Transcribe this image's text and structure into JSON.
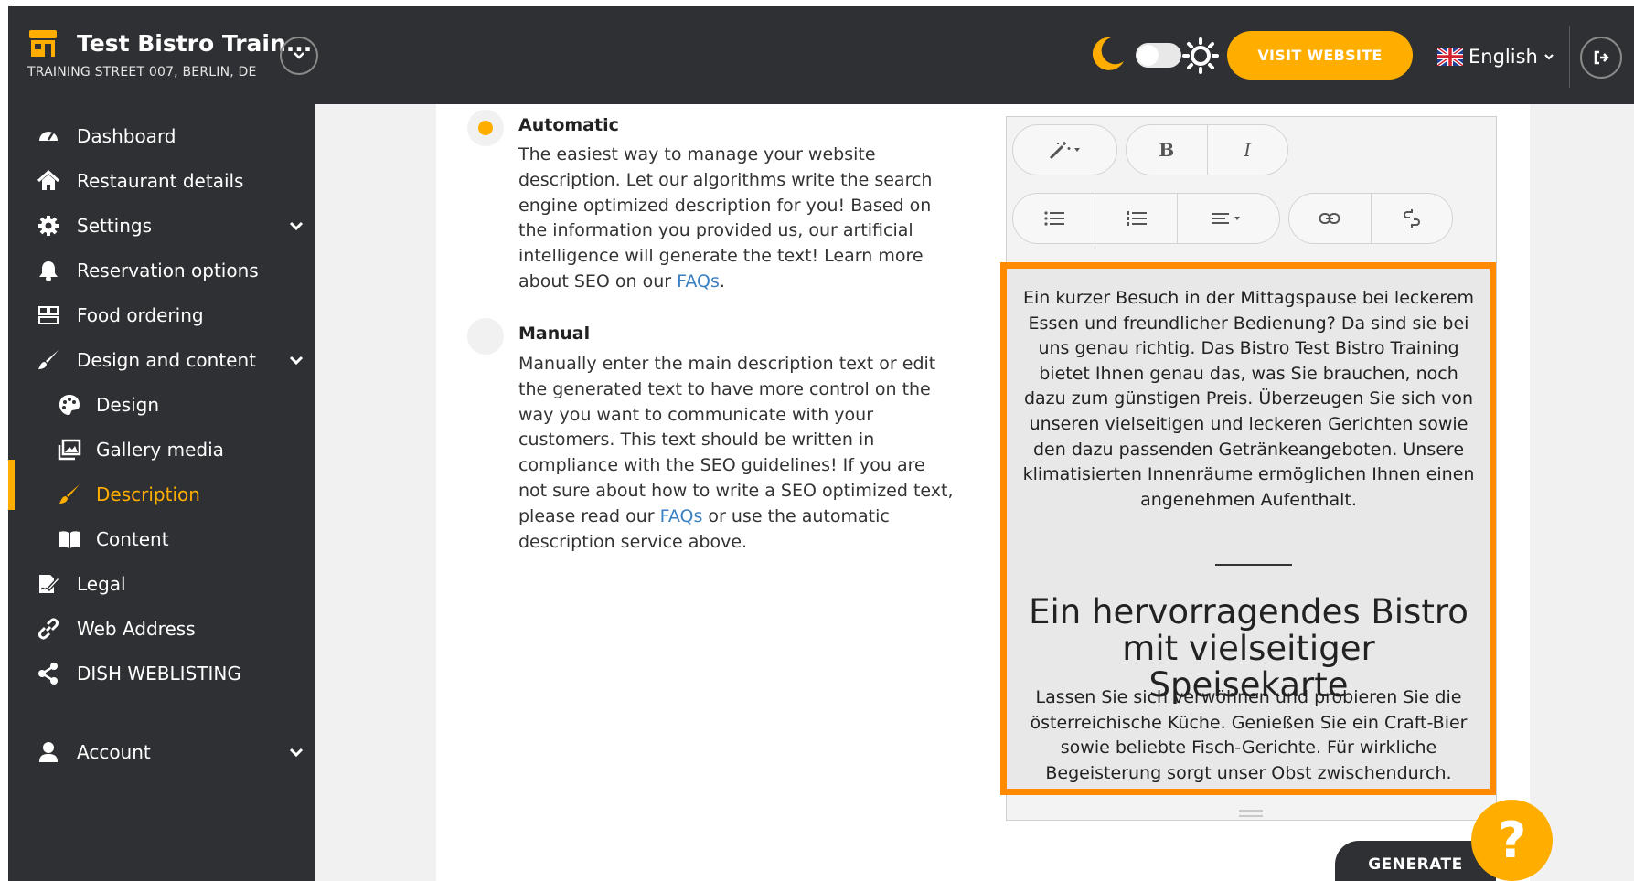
{
  "header": {
    "restaurant_name": "Test Bistro Train...",
    "address": "TRAINING STREET 007, BERLIN, DE",
    "visit_website": "VISIT WEBSITE",
    "language": "English"
  },
  "sidebar": {
    "items": [
      {
        "label": "Dashboard",
        "icon": "dashboard-icon"
      },
      {
        "label": "Restaurant details",
        "icon": "home-icon"
      },
      {
        "label": "Settings",
        "icon": "gear-icon"
      },
      {
        "label": "Reservation options",
        "icon": "bell-icon"
      },
      {
        "label": "Food ordering",
        "icon": "food-ordering-icon"
      },
      {
        "label": "Design and content",
        "icon": "paint-brush-icon"
      },
      {
        "label": "Design",
        "icon": "palette-icon"
      },
      {
        "label": "Gallery media",
        "icon": "gallery-icon"
      },
      {
        "label": "Description",
        "icon": "brush-icon"
      },
      {
        "label": "Content",
        "icon": "book-icon"
      },
      {
        "label": "Legal",
        "icon": "signature-icon"
      },
      {
        "label": "Web Address",
        "icon": "link-icon"
      },
      {
        "label": "DISH WEBLISTING",
        "icon": "share-icon"
      },
      {
        "label": "Account",
        "icon": "user-icon"
      }
    ]
  },
  "options": {
    "automatic": {
      "title": "Automatic",
      "text": "The easiest way to manage your website description. Let our algorithms write the search engine optimized description for you! Based on the information you provided us, our artificial intelligence will generate the text! Learn more about SEO on our",
      "link": "FAQs",
      "after": "."
    },
    "manual": {
      "title": "Manual",
      "text": "Manually enter the main description text or edit the generated text to have more control on the way you want to communicate with your customers. This text should be written in compliance with the SEO guidelines! If you are not sure about how to write a SEO optimized text, please read our",
      "link": "FAQs",
      "after": " or use the automatic description service above."
    }
  },
  "editor": {
    "bold": "B",
    "italic": "I",
    "paragraph1": "Ein kurzer Besuch in der Mittagspause bei leckerem Essen und freundlicher Bedienung? Da sind sie bei uns genau richtig. Das Bistro Test Bistro Training bietet Ihnen genau das, was Sie brauchen, noch dazu zum günstigen Preis. Überzeugen Sie sich von unseren vielseitigen und leckeren Gerichten sowie den dazu passenden Getränkeangeboten. Unsere klimatisierten Innenräume ermöglichen Ihnen einen angenehmen Aufenthalt.",
    "heading": "Ein hervorragendes Bistro mit vielseitiger Speisekarte",
    "paragraph2": "Lassen Sie sich verwöhnen und probieren Sie die österreichische Küche. Genießen Sie ein Craft-Bier sowie beliebte Fisch-Gerichte. Für wirkliche Begeisterung sorgt unser Obst zwischendurch."
  },
  "actions": {
    "generate": "GENERATE",
    "help": "?"
  },
  "colors": {
    "accent": "#ffae00",
    "highlight": "#ff8a00",
    "dark": "#2f3033",
    "link": "#3a7fc1"
  }
}
